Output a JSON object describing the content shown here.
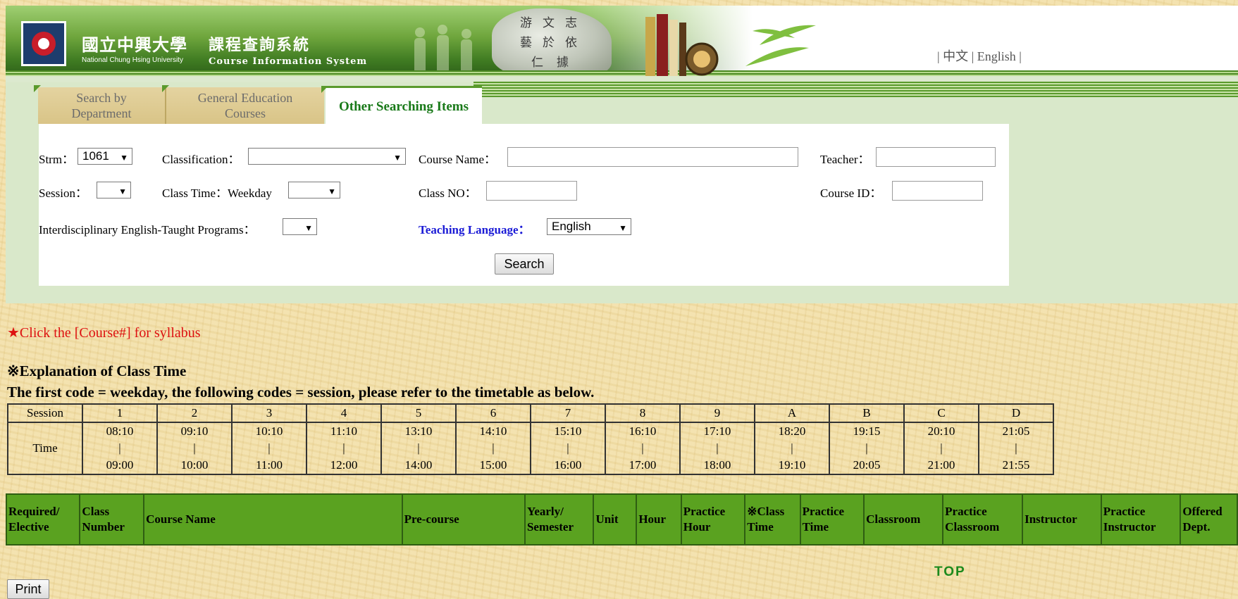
{
  "header": {
    "school_cn": "國立中興大學",
    "system_cn": "課程查詢系統",
    "school_en": "National Chung Hsing University",
    "system_en": "Course Information System",
    "stone_text": [
      "游",
      "文",
      "志",
      "藝",
      "於",
      "依",
      "仁",
      "據"
    ],
    "lang_sep": "|",
    "lang_cn": "中文",
    "lang_en": "English"
  },
  "tabs": [
    {
      "label_l1": "Search by",
      "label_l2": "Department"
    },
    {
      "label_l1": "General Education",
      "label_l2": "Courses"
    },
    {
      "label": "Other Searching Items"
    }
  ],
  "form": {
    "strm_label": "Strm：",
    "strm_value": "1061",
    "classification_label": "Classification：",
    "classification_value": "",
    "course_name_label": "Course Name：",
    "teacher_label": "Teacher：",
    "session_label": "Session：",
    "session_value": "",
    "class_time_label": "Class Time：Weekday",
    "weekday_value": "",
    "class_no_label": "Class NO：",
    "course_id_label": "Course ID：",
    "interdisciplinary_label": "Interdisciplinary English-Taught Programs：",
    "interdisciplinary_value": "",
    "teaching_language_label": "Teaching Language：",
    "teaching_language_value": "English",
    "search_button": "Search"
  },
  "notes": {
    "syllabus_hint": "★Click the [Course#] for syllabus",
    "explanation_title": "※Explanation of Class Time",
    "explanation_text": "The first code = weekday, the following codes = session, please refer to the timetable as below."
  },
  "timetable": {
    "session_label": "Session",
    "time_label": "Time",
    "separator": "|",
    "sessions": [
      {
        "code": "1",
        "start": "08:10",
        "end": "09:00"
      },
      {
        "code": "2",
        "start": "09:10",
        "end": "10:00"
      },
      {
        "code": "3",
        "start": "10:10",
        "end": "11:00"
      },
      {
        "code": "4",
        "start": "11:10",
        "end": "12:00"
      },
      {
        "code": "5",
        "start": "13:10",
        "end": "14:00"
      },
      {
        "code": "6",
        "start": "14:10",
        "end": "15:00"
      },
      {
        "code": "7",
        "start": "15:10",
        "end": "16:00"
      },
      {
        "code": "8",
        "start": "16:10",
        "end": "17:00"
      },
      {
        "code": "9",
        "start": "17:10",
        "end": "18:00"
      },
      {
        "code": "A",
        "start": "18:20",
        "end": "19:10"
      },
      {
        "code": "B",
        "start": "19:15",
        "end": "20:05"
      },
      {
        "code": "C",
        "start": "20:10",
        "end": "21:00"
      },
      {
        "code": "D",
        "start": "21:05",
        "end": "21:55"
      }
    ]
  },
  "results_header": [
    {
      "l1": "Required/",
      "l2": "Elective"
    },
    {
      "l1": "Class",
      "l2": "Number"
    },
    {
      "l1": "Course Name",
      "l2": ""
    },
    {
      "l1": "Pre-course",
      "l2": ""
    },
    {
      "l1": "Yearly/",
      "l2": "Semester"
    },
    {
      "l1": "Unit",
      "l2": ""
    },
    {
      "l1": "Hour",
      "l2": ""
    },
    {
      "l1": "Practice",
      "l2": "Hour"
    },
    {
      "l1": "※Class",
      "l2": "Time"
    },
    {
      "l1": "Practice",
      "l2": "Time"
    },
    {
      "l1": "Classroom",
      "l2": ""
    },
    {
      "l1": "Practice",
      "l2": "Classroom"
    },
    {
      "l1": "Instructor",
      "l2": ""
    },
    {
      "l1": "Practice",
      "l2": "Instructor"
    },
    {
      "l1": "Offered",
      "l2": "Dept."
    }
  ],
  "footer": {
    "top_link": "TOP",
    "print_button": "Print"
  },
  "colors": {
    "accent_green": "#5aa220",
    "active_tab_text": "#1a7a1a",
    "note_red": "#dd1111",
    "label_blue": "#1b1bd6"
  }
}
